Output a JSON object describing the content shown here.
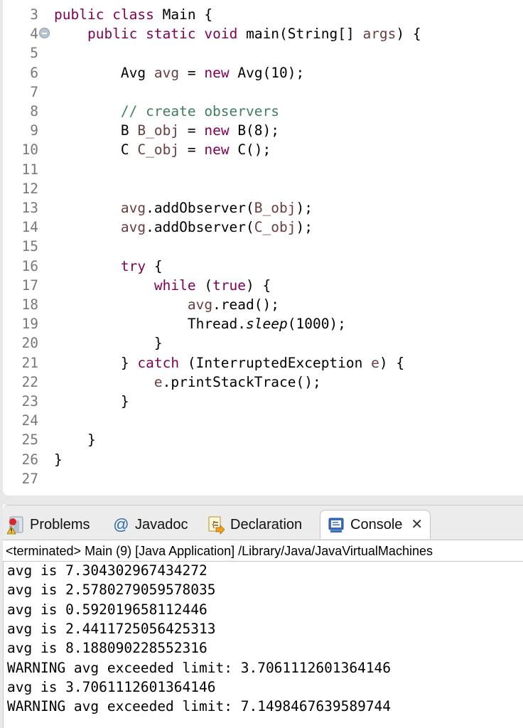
{
  "editor": {
    "lines": [
      {
        "num": "3",
        "html": "<span class=\"kw\">public</span> <span class=\"kw\">class</span> Main {"
      },
      {
        "num": "4",
        "fold": true,
        "html": "    <span class=\"kw\">public</span> <span class=\"kw\">static</span> <span class=\"kw\">void</span> main(String[] <span class=\"var\">args</span>) {"
      },
      {
        "num": "5",
        "html": ""
      },
      {
        "num": "6",
        "html": "        Avg <span class=\"var\">avg</span> = <span class=\"kw\">new</span> Avg(10);"
      },
      {
        "num": "7",
        "html": ""
      },
      {
        "num": "8",
        "html": "        <span class=\"cm\">// create observers</span>"
      },
      {
        "num": "9",
        "html": "        B <span class=\"var\">B_obj</span> = <span class=\"kw\">new</span> B(8);"
      },
      {
        "num": "10",
        "html": "        C <span class=\"var\">C_obj</span> = <span class=\"kw\">new</span> C();"
      },
      {
        "num": "11",
        "html": ""
      },
      {
        "num": "12",
        "html": ""
      },
      {
        "num": "13",
        "html": "        <span class=\"var\">avg</span>.addObserver(<span class=\"var\">B_obj</span>);"
      },
      {
        "num": "14",
        "html": "        <span class=\"var\">avg</span>.addObserver(<span class=\"var\">C_obj</span>);"
      },
      {
        "num": "15",
        "html": ""
      },
      {
        "num": "16",
        "html": "        <span class=\"kw\">try</span> {"
      },
      {
        "num": "17",
        "html": "            <span class=\"kw\">while</span> (<span class=\"kw\">true</span>) {"
      },
      {
        "num": "18",
        "html": "                <span class=\"var\">avg</span>.read();"
      },
      {
        "num": "19",
        "html": "                Thread.<span class=\"it\">sleep</span>(1000);"
      },
      {
        "num": "20",
        "html": "            }"
      },
      {
        "num": "21",
        "html": "        } <span class=\"kw\">catch</span> (InterruptedException <span class=\"var\">e</span>) {"
      },
      {
        "num": "22",
        "html": "            <span class=\"var\">e</span>.printStackTrace();"
      },
      {
        "num": "23",
        "html": "        }"
      },
      {
        "num": "24",
        "html": ""
      },
      {
        "num": "25",
        "html": "    }"
      },
      {
        "num": "26",
        "html": "}"
      },
      {
        "num": "27",
        "html": ""
      }
    ]
  },
  "panel": {
    "tabs": [
      {
        "label": "Problems",
        "icon": "problems-icon"
      },
      {
        "label": "Javadoc",
        "icon": "javadoc-at-icon"
      },
      {
        "label": "Declaration",
        "icon": "declaration-icon"
      },
      {
        "label": "Console",
        "icon": "console-icon",
        "active": true
      }
    ],
    "close_glyph": "✕",
    "status": "<terminated> Main (9) [Java Application] /Library/Java/JavaVirtualMachines",
    "output": [
      "avg is 7.304302967434272",
      "avg is 2.5780279059578035",
      "avg is 0.592019658112446",
      "avg is 2.4411725056425313",
      "avg is 8.188090228552316",
      "WARNING avg exceeded limit: 3.7061112601364146",
      "avg is 3.7061112601364146",
      "WARNING avg exceeded limit: 7.1498467639589744"
    ]
  }
}
